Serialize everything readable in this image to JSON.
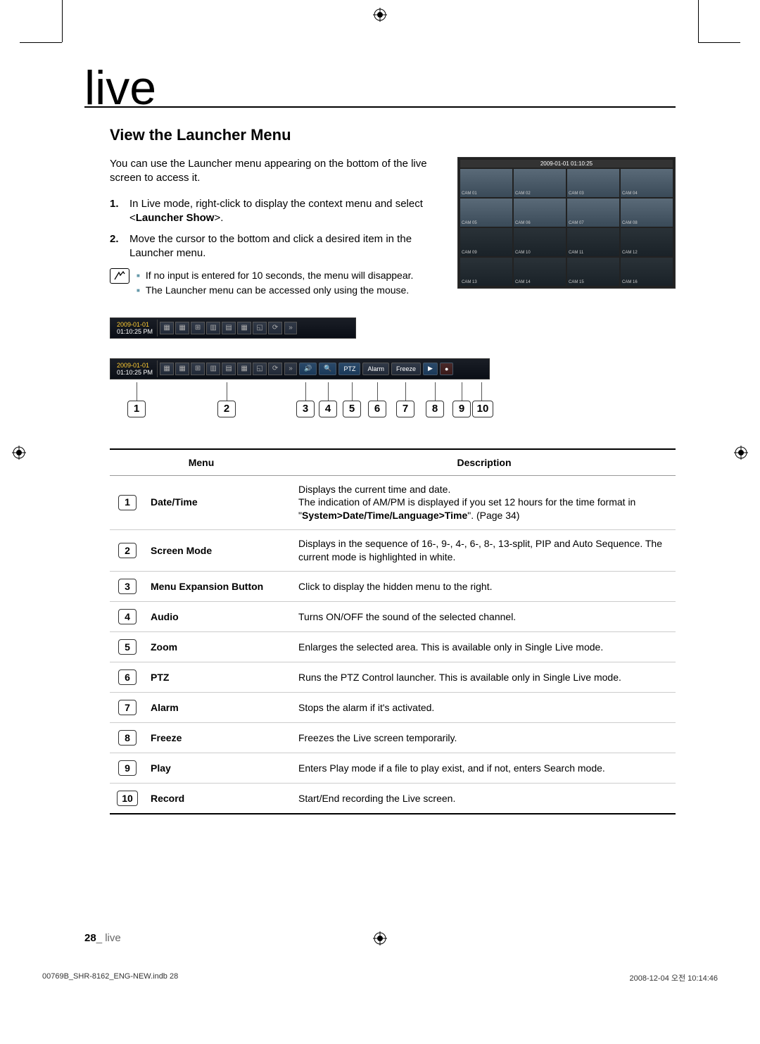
{
  "chapter_title": "live",
  "section_title": "View the Launcher Menu",
  "intro": "You can use the Launcher menu appearing on the bottom of the live screen to access it.",
  "steps": [
    {
      "text": "In Live mode, right-click to display the context menu and select <",
      "bold": "Launcher Show",
      "after": ">."
    },
    {
      "text": "Move the cursor to the bottom and click a desired item in the Launcher menu."
    }
  ],
  "notes": [
    "If no input is entered for 10 seconds, the menu will disappear.",
    "The Launcher menu can be accessed only using the mouse."
  ],
  "grid_timestamp": "2009-01-01 01:10:25",
  "cam_labels": [
    "CAM 01",
    "CAM 02",
    "CAM 03",
    "CAM 04",
    "CAM 05",
    "CAM 06",
    "CAM 07",
    "CAM 08",
    "CAM 09",
    "CAM 10",
    "CAM 11",
    "CAM 12",
    "CAM 13",
    "CAM 14",
    "CAM 15",
    "CAM 16"
  ],
  "launcher_date": "2009-01-01",
  "launcher_time": "01:10:25  PM",
  "expanded_labels": {
    "ptz": "PTZ",
    "alarm": "Alarm",
    "freeze": "Freeze",
    "play": "▶",
    "record": "●",
    "audio": "🔊",
    "zoom": "🔍",
    "expand": "»"
  },
  "table": {
    "head": {
      "menu": "Menu",
      "desc": "Description"
    },
    "rows": [
      {
        "num": "1",
        "name": "Date/Time",
        "desc": "Displays the current time and date.\nThe indication of AM/PM is displayed if you set 12 hours for the time format in \"System>Date/Time/Language>Time\". (Page 34)"
      },
      {
        "num": "2",
        "name": "Screen Mode",
        "desc": "Displays in the sequence of 16-, 9-, 4-, 6-, 8-, 13-split, PIP and Auto Sequence. The current mode is highlighted in white."
      },
      {
        "num": "3",
        "name": "Menu Expansion Button",
        "desc": "Click to display the hidden menu to the right."
      },
      {
        "num": "4",
        "name": "Audio",
        "desc": "Turns ON/OFF the sound of the selected channel."
      },
      {
        "num": "5",
        "name": "Zoom",
        "desc": "Enlarges the selected area. This is available only in Single Live mode."
      },
      {
        "num": "6",
        "name": "PTZ",
        "desc": "Runs the PTZ Control launcher. This is available only in Single Live mode."
      },
      {
        "num": "7",
        "name": "Alarm",
        "desc": "Stops the alarm if it's activated."
      },
      {
        "num": "8",
        "name": "Freeze",
        "desc": "Freezes the Live screen temporarily."
      },
      {
        "num": "9",
        "name": "Play",
        "desc": "Enters Play mode if a file to play exist, and if not, enters Search mode."
      },
      {
        "num": "10",
        "name": "Record",
        "desc": "Start/End recording the Live screen."
      }
    ]
  },
  "desc_row1_plain1": "Displays the current time and date.",
  "desc_row1_plain2": "The indication of AM/PM is displayed if you set 12 hours for the time format in \"",
  "desc_row1_bold": "System>Date/Time/Language>Time",
  "desc_row1_plain3": "\". (Page 34)",
  "footer_page": "28",
  "footer_section": "_ live",
  "print_left": "00769B_SHR-8162_ENG-NEW.indb   28",
  "print_right": "2008-12-04   오전 10:14:46"
}
